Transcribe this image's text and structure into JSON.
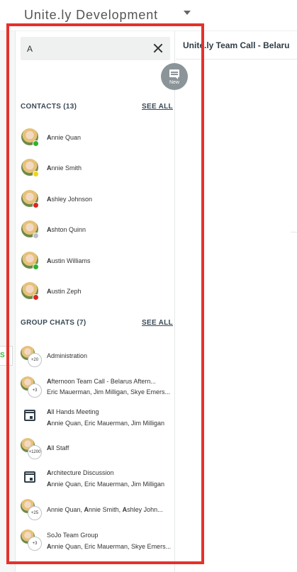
{
  "workspace": {
    "name": "Unite.ly Development"
  },
  "search": {
    "value": "A"
  },
  "new_button": {
    "label": "New"
  },
  "contacts": {
    "header": "CONTACTS (13)",
    "see_all": "SEE ALL",
    "items": [
      {
        "first": "A",
        "rest": "nnie Quan",
        "status_color": "#2db32d"
      },
      {
        "first": "A",
        "rest": "nnie Smith",
        "status_color": "#f2d21b"
      },
      {
        "first": "A",
        "rest": "shley Johnson",
        "status_color": "#d92626"
      },
      {
        "first": "A",
        "rest": "shton Quinn",
        "status_color": "#b9bfc3"
      },
      {
        "first": "A",
        "rest": "ustin Williams",
        "status_color": "#2db32d"
      },
      {
        "first": "A",
        "rest": "ustin Zeph",
        "status_color": "#d92626"
      }
    ]
  },
  "group_chats": {
    "header": "GROUP CHATS (7)",
    "see_all": "SEE ALL",
    "items": [
      {
        "title_first": "",
        "title_rest": "Administration",
        "sub": "",
        "count": "+20"
      },
      {
        "title_first": "A",
        "title_rest": "fternoon Team Call - Belarus Aftern...",
        "sub": "Eric Mauerman, Jim Milligan, Skye Emers...",
        "count": "+3"
      },
      {
        "title_first": "A",
        "title_rest": "ll Hands Meeting",
        "sub_first": "A",
        "sub": "nnie Quan, Eric Mauerman, Jim Milligan",
        "icon": "calendar-icon"
      },
      {
        "title_first": "A",
        "title_rest": "ll Staff",
        "sub": "",
        "count": "+1200"
      },
      {
        "title_first": "A",
        "title_rest": "rchitecture Discussion",
        "sub_first": "A",
        "sub": "nnie Quan, Eric Mauerman, Jim Milligan",
        "icon": "calendar-icon"
      },
      {
        "title_plain": "Annie Quan, ",
        "title_a2": "A",
        "title_mid": "nnie Smith, ",
        "title_a3": "A",
        "title_end": "shley John...",
        "count": "+25"
      },
      {
        "title_first": "",
        "title_rest": "SoJo Team Group",
        "sub_first": "A",
        "sub": "nnie Quan, Eric Mauerman, Skye Emers...",
        "count": "+3"
      }
    ]
  },
  "channel": {
    "title": "Unite.ly Team Call - Belaru"
  },
  "left_strip": {
    "mark": "S"
  }
}
